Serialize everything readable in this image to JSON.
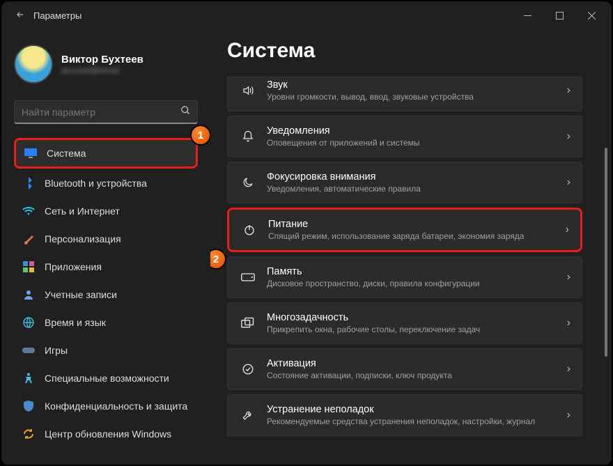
{
  "window": {
    "title": "Параметры"
  },
  "user": {
    "name": "Виктор Бухтеев",
    "email": "account@email"
  },
  "search": {
    "placeholder": "Найти параметр"
  },
  "sidebar": {
    "items": [
      {
        "label": "Система"
      },
      {
        "label": "Bluetooth и устройства"
      },
      {
        "label": "Сеть и Интернет"
      },
      {
        "label": "Персонализация"
      },
      {
        "label": "Приложения"
      },
      {
        "label": "Учетные записи"
      },
      {
        "label": "Время и язык"
      },
      {
        "label": "Игры"
      },
      {
        "label": "Специальные возможности"
      },
      {
        "label": "Конфиденциальность и защита"
      },
      {
        "label": "Центр обновления Windows"
      }
    ]
  },
  "main": {
    "heading": "Система",
    "panels": [
      {
        "title": "Звук",
        "sub": "Уровни громкости, вывод, ввод, звуковые устройства"
      },
      {
        "title": "Уведомления",
        "sub": "Оповещения от приложений и системы"
      },
      {
        "title": "Фокусировка внимания",
        "sub": "Уведомления, автоматические правила"
      },
      {
        "title": "Питание",
        "sub": "Спящий режим, использование заряда батареи, экономия заряда"
      },
      {
        "title": "Память",
        "sub": "Дисковое пространство, диски, правила конфигурации"
      },
      {
        "title": "Многозадачность",
        "sub": "Прикрепить окна, рабочие столы, переключение задач"
      },
      {
        "title": "Активация",
        "sub": "Состояние активации, подписки, ключ продукта"
      },
      {
        "title": "Устранение неполадок",
        "sub": "Рекомендуемые средства устранения неполадок, настройки, журнал"
      }
    ]
  },
  "badges": {
    "one": "1",
    "two": "2"
  }
}
